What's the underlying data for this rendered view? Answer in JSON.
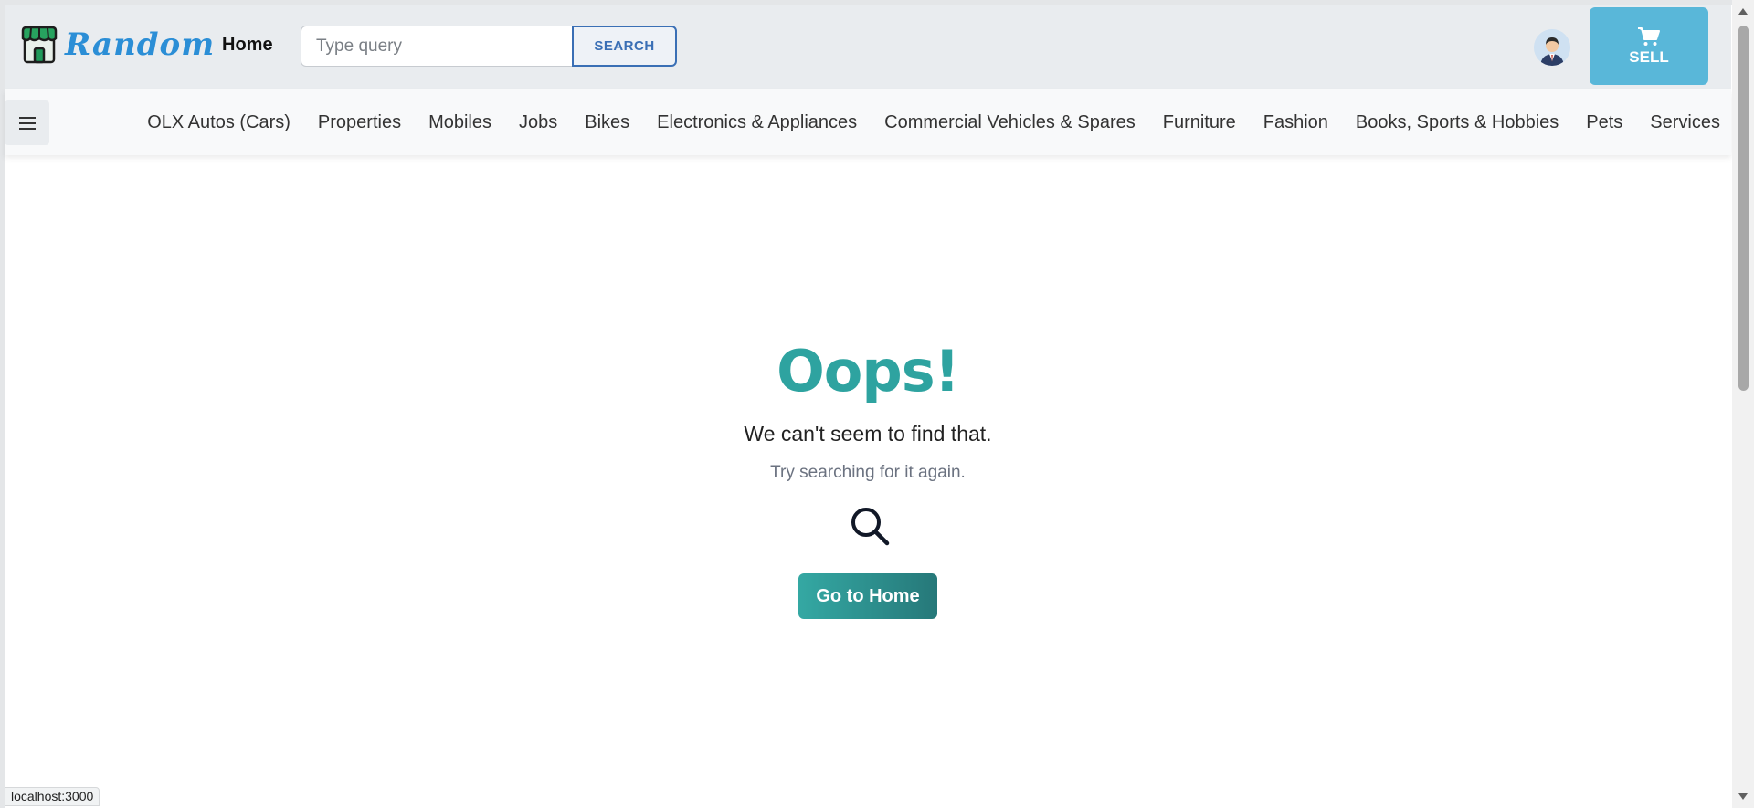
{
  "header": {
    "logo_text": "Random",
    "home_label": "Home",
    "search_placeholder": "Type query",
    "search_button_label": "SEARCH",
    "sell_label": "SELL"
  },
  "categories": [
    "OLX Autos (Cars)",
    "Properties",
    "Mobiles",
    "Jobs",
    "Bikes",
    "Electronics & Appliances",
    "Commercial Vehicles & Spares",
    "Furniture",
    "Fashion",
    "Books, Sports & Hobbies",
    "Pets",
    "Services"
  ],
  "main": {
    "title": "Oops!",
    "message": "We can't seem to find that.",
    "hint": "Try searching for it again.",
    "home_button_label": "Go to Home"
  },
  "status_bar": {
    "url": "localhost:3000"
  },
  "colors": {
    "accent": "#2ea3a0",
    "sell": "#59b7d9",
    "logo": "#2b8ed6"
  }
}
